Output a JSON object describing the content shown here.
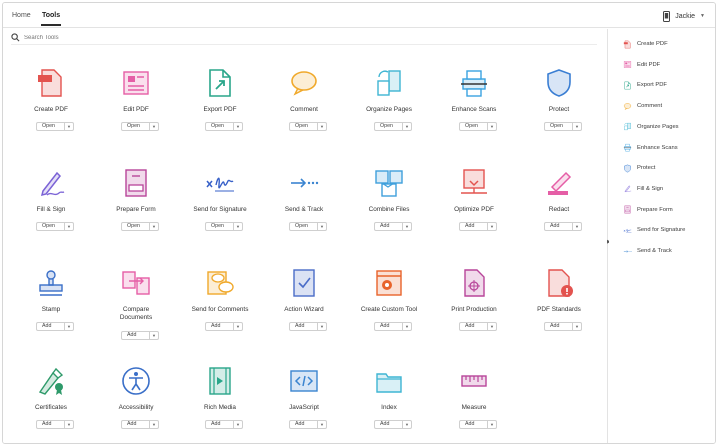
{
  "nav": {
    "home": "Home",
    "tools": "Tools"
  },
  "user": {
    "name": "Jackie"
  },
  "search": {
    "placeholder": "Search Tools"
  },
  "tools": [
    {
      "label": "Create PDF",
      "action": "Open",
      "icon": "create-pdf-icon",
      "color": "#e3534f"
    },
    {
      "label": "Edit PDF",
      "action": "Open",
      "icon": "edit-pdf-icon",
      "color": "#e55ea6"
    },
    {
      "label": "Export PDF",
      "action": "Open",
      "icon": "export-pdf-icon",
      "color": "#2aa68a"
    },
    {
      "label": "Comment",
      "action": "Open",
      "icon": "comment-icon",
      "color": "#f0a92b"
    },
    {
      "label": "Organize Pages",
      "action": "Open",
      "icon": "organize-pages-icon",
      "color": "#3fb5d3"
    },
    {
      "label": "Enhance Scans",
      "action": "Open",
      "icon": "enhance-scans-icon",
      "color": "#3aa3e0"
    },
    {
      "label": "Protect",
      "action": "Open",
      "icon": "protect-icon",
      "color": "#3a7ed3"
    },
    {
      "label": "Fill & Sign",
      "action": "Open",
      "icon": "fill-sign-icon",
      "color": "#7b63d6"
    },
    {
      "label": "Prepare Form",
      "action": "Open",
      "icon": "prepare-form-icon",
      "color": "#b8459a"
    },
    {
      "label": "Send for Signature",
      "action": "Open",
      "icon": "send-signature-icon",
      "color": "#3760c8"
    },
    {
      "label": "Send & Track",
      "action": "Open",
      "icon": "send-track-icon",
      "color": "#3a84d0"
    },
    {
      "label": "Combine Files",
      "action": "Add",
      "icon": "combine-files-icon",
      "color": "#3fa0dc"
    },
    {
      "label": "Optimize PDF",
      "action": "Add",
      "icon": "optimize-pdf-icon",
      "color": "#e3534f"
    },
    {
      "label": "Redact",
      "action": "Add",
      "icon": "redact-icon",
      "color": "#e55ea6"
    },
    {
      "label": "Stamp",
      "action": "Add",
      "icon": "stamp-icon",
      "color": "#3a6fc8"
    },
    {
      "label": "Compare Documents",
      "action": "Add",
      "icon": "compare-documents-icon",
      "color": "#e55ea6"
    },
    {
      "label": "Send for Comments",
      "action": "Add",
      "icon": "send-comments-icon",
      "color": "#f0a92b"
    },
    {
      "label": "Action Wizard",
      "action": "Add",
      "icon": "action-wizard-icon",
      "color": "#4a6cc8"
    },
    {
      "label": "Create Custom Tool",
      "action": "Add",
      "icon": "create-custom-tool-icon",
      "color": "#e8632b"
    },
    {
      "label": "Print Production",
      "action": "Add",
      "icon": "print-production-icon",
      "color": "#b8459a"
    },
    {
      "label": "PDF Standards",
      "action": "Add",
      "icon": "pdf-standards-icon",
      "color": "#e3534f"
    },
    {
      "label": "Certificates",
      "action": "Add",
      "icon": "certificates-icon",
      "color": "#2e9a6a"
    },
    {
      "label": "Accessibility",
      "action": "Add",
      "icon": "accessibility-icon",
      "color": "#3a6fc8"
    },
    {
      "label": "Rich Media",
      "action": "Add",
      "icon": "rich-media-icon",
      "color": "#2aa68a"
    },
    {
      "label": "JavaScript",
      "action": "Add",
      "icon": "javascript-icon",
      "color": "#3a84d0"
    },
    {
      "label": "Index",
      "action": "Add",
      "icon": "index-icon",
      "color": "#3fb5d3"
    },
    {
      "label": "Measure",
      "action": "Add",
      "icon": "measure-icon",
      "color": "#b8459a"
    }
  ],
  "right_panel": [
    {
      "label": "Create PDF",
      "icon": "create-pdf-icon",
      "color": "#e3534f"
    },
    {
      "label": "Edit PDF",
      "icon": "edit-pdf-icon",
      "color": "#e55ea6"
    },
    {
      "label": "Export PDF",
      "icon": "export-pdf-icon",
      "color": "#2aa68a"
    },
    {
      "label": "Comment",
      "icon": "comment-icon",
      "color": "#f0a92b"
    },
    {
      "label": "Organize Pages",
      "icon": "organize-pages-icon",
      "color": "#3fb5d3"
    },
    {
      "label": "Enhance Scans",
      "icon": "enhance-scans-icon",
      "color": "#3aa3e0"
    },
    {
      "label": "Protect",
      "icon": "protect-icon",
      "color": "#3a7ed3"
    },
    {
      "label": "Fill & Sign",
      "icon": "fill-sign-icon",
      "color": "#7b63d6"
    },
    {
      "label": "Prepare Form",
      "icon": "prepare-form-icon",
      "color": "#b8459a"
    },
    {
      "label": "Send for Signature",
      "icon": "send-signature-icon",
      "color": "#3760c8"
    },
    {
      "label": "Send & Track",
      "icon": "send-track-icon",
      "color": "#3a84d0"
    }
  ]
}
